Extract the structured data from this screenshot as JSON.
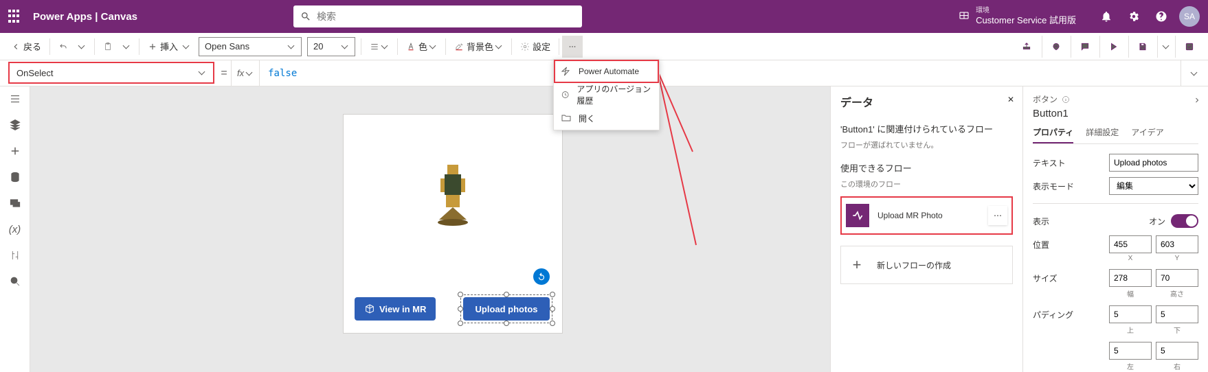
{
  "header": {
    "title": "Power Apps  |  Canvas",
    "search_placeholder": "検索",
    "env_label": "環境",
    "env_value": "Customer Service 試用版",
    "avatar": "SA"
  },
  "toolbar": {
    "back": "戻る",
    "insert": "挿入",
    "font": "Open Sans",
    "size": "20",
    "color": "色",
    "bgcolor": "背景色",
    "settings": "設定"
  },
  "formula": {
    "property": "OnSelect",
    "fx": "fx",
    "value": "false"
  },
  "contextmenu": {
    "powerautomate": "Power Automate",
    "versionhistory": "アプリのバージョン履歴",
    "open": "開く"
  },
  "canvas": {
    "view_in_mr": "View in MR",
    "upload_photos": "Upload photos"
  },
  "datapane": {
    "title": "データ",
    "related_flow": "'Button1' に関連付けられているフロー",
    "noflow": "フローが選ばれていません。",
    "usable_flows": "使用できるフロー",
    "env_flows": "この環境のフロー",
    "flow_name": "Upload MR Photo",
    "new_flow": "新しいフローの作成"
  },
  "proppane": {
    "kind": "ボタン",
    "name": "Button1",
    "tabs": {
      "properties": "プロパティ",
      "advanced": "詳細設定",
      "ideas": "アイデア"
    },
    "text_label": "テキスト",
    "text_value": "Upload photos",
    "displaymode_label": "表示モード",
    "displaymode_value": "編集",
    "visible_label": "表示",
    "visible_on": "オン",
    "position_label": "位置",
    "pos_x": "455",
    "pos_y": "603",
    "ax_x": "X",
    "ax_y": "Y",
    "size_label": "サイズ",
    "size_w": "278",
    "size_h": "70",
    "ax_w": "幅",
    "ax_h": "高さ",
    "padding_label": "パディング",
    "pad_t": "5",
    "pad_b": "5",
    "ax_t": "上",
    "ax_b": "下",
    "pad_l": "5",
    "pad_r": "5",
    "ax_l": "左",
    "ax_r": "右"
  }
}
